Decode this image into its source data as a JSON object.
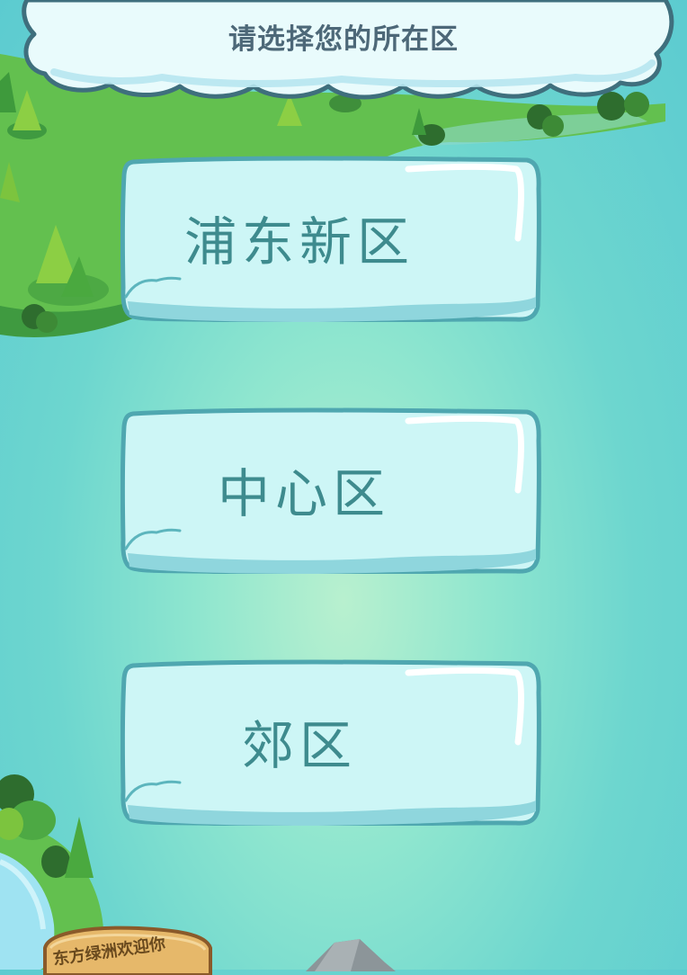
{
  "header": {
    "title": "请选择您的所在区"
  },
  "districts": [
    {
      "label": "浦东新区"
    },
    {
      "label": "中心区"
    },
    {
      "label": "郊区"
    }
  ],
  "sign": {
    "text": "东方绿洲欢迎你"
  },
  "colors": {
    "background_center": "#b8f0cf",
    "background_edge": "#5ccbd0",
    "button_fill": "#cdf6f6",
    "button_border": "#4fa7b0",
    "button_text": "#3e8b8e",
    "title_text": "#4d6878",
    "island_green": "#5fbf4c"
  },
  "icons": [
    "cloud-banner",
    "island",
    "tree-icon",
    "bird-icon",
    "wooden-sign",
    "rock"
  ]
}
